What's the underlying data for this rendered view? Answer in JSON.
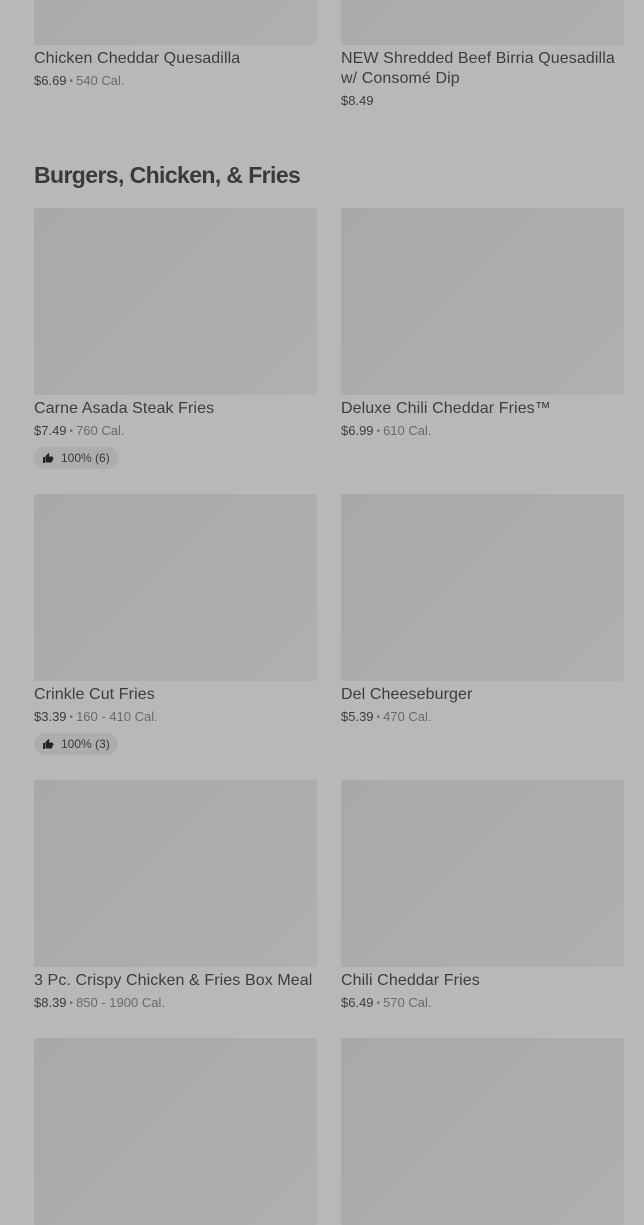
{
  "top_items": [
    {
      "name": "Chicken Cheddar Quesadilla",
      "price": "$6.69",
      "sep": "•",
      "cal": "540 Cal."
    },
    {
      "name": "NEW Shredded Beef Birria Quesadilla w/ Consomé Dip",
      "price": "$8.49"
    }
  ],
  "section": {
    "title": "Burgers, Chicken, & Fries",
    "items": [
      {
        "name": "Carne Asada Steak Fries",
        "price": "$7.49",
        "sep": "•",
        "cal": "760 Cal.",
        "rating": "100% (6)",
        "icon": "thumbs-up-icon"
      },
      {
        "name": "Deluxe Chili Cheddar Fries™",
        "price": "$6.99",
        "sep": "•",
        "cal": "610 Cal."
      },
      {
        "name": "Crinkle Cut Fries",
        "price": "$3.39",
        "sep": "•",
        "cal": "160 - 410 Cal.",
        "rating": "100% (3)",
        "icon": "thumbs-up-icon"
      },
      {
        "name": "Del Cheeseburger",
        "price": "$5.39",
        "sep": "•",
        "cal": "470 Cal."
      },
      {
        "name": "3 Pc. Crispy Chicken & Fries Box Meal",
        "price": "$8.39",
        "sep": "•",
        "cal": "850 - 1900 Cal."
      },
      {
        "name": "Chili Cheddar Fries",
        "price": "$6.49",
        "sep": "•",
        "cal": "570 Cal."
      }
    ]
  }
}
